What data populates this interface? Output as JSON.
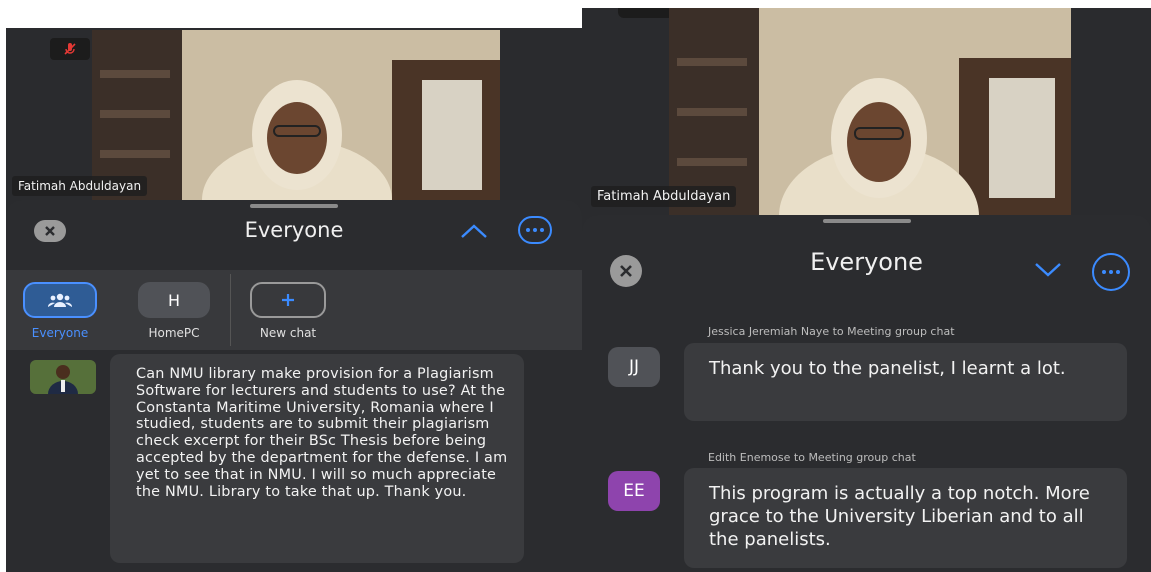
{
  "left_screen": {
    "video": {
      "participant_name": "Fatimah Abduldayan",
      "mic_status_icon": "mic-muted-icon"
    },
    "chat_header": {
      "title": "Everyone"
    },
    "chat_targets": [
      {
        "label": "Everyone",
        "icon": "people-icon"
      },
      {
        "label": "HomePC",
        "initial": "H"
      },
      {
        "label": "New chat",
        "icon": "plus-icon"
      }
    ],
    "message": {
      "text": "Can NMU library make provision for a Plagiarism Software for lecturers and students to use? At the Constanta Maritime University, Romania where I studied, students are to submit their plagiarism check excerpt for their BSc Thesis before being accepted by the department for the defense. I am yet to see that in NMU. I will so much appreciate the NMU. Library to take that up. Thank you."
    }
  },
  "right_screen": {
    "video": {
      "participant_name": "Fatimah Abduldayan"
    },
    "chat_header": {
      "title": "Everyone"
    },
    "messages": [
      {
        "sender_line": "Jessica Jeremiah Naye to Meeting group chat",
        "initials": "JJ",
        "text": "Thank you to the panelist, I learnt a lot."
      },
      {
        "sender_line": "Edith Enemose to Meeting group chat",
        "initials": "EE",
        "text": "This program is actually a top notch. More grace to the University Liberian and to all the panelists."
      }
    ]
  },
  "colors": {
    "accent": "#3b8bff",
    "sheet_bg": "#2b2c2f",
    "bubble_bg": "#3a3b3e",
    "avatar_jj": "#505257",
    "avatar_ee": "#8e44ad"
  }
}
